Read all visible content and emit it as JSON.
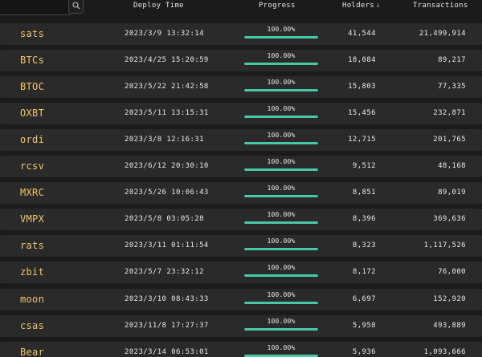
{
  "search": {
    "placeholder": ""
  },
  "header": {
    "deploy_time": "Deploy Time",
    "progress": "Progress",
    "holders": "Holders",
    "holders_sort_indicator": "↓",
    "transactions": "Transactions"
  },
  "colors": {
    "ticker": "#f2c66d",
    "progress_fill": "#46c9a6",
    "sort_arrow": "#f5a05a"
  },
  "rows": [
    {
      "ticker": "sats",
      "deploy_time": "2023/3/9 13:32:14",
      "progress": "100.00%",
      "progress_value": 100,
      "holders": "41,544",
      "transactions": "21,499,914"
    },
    {
      "ticker": "BTCs",
      "deploy_time": "2023/4/25 15:20:59",
      "progress": "100.00%",
      "progress_value": 100,
      "holders": "18,084",
      "transactions": "89,217"
    },
    {
      "ticker": "BTOC",
      "deploy_time": "2023/5/22 21:42:58",
      "progress": "100.00%",
      "progress_value": 100,
      "holders": "15,803",
      "transactions": "77,335"
    },
    {
      "ticker": "OXBT",
      "deploy_time": "2023/5/11 13:15:31",
      "progress": "100.00%",
      "progress_value": 100,
      "holders": "15,456",
      "transactions": "232,871"
    },
    {
      "ticker": "ordi",
      "deploy_time": "2023/3/8 12:16:31",
      "progress": "100.00%",
      "progress_value": 100,
      "holders": "12,715",
      "transactions": "201,765"
    },
    {
      "ticker": "rcsv",
      "deploy_time": "2023/6/12 20:30:10",
      "progress": "100.00%",
      "progress_value": 100,
      "holders": "9,512",
      "transactions": "48,168"
    },
    {
      "ticker": "MXRC",
      "deploy_time": "2023/5/26 10:06:43",
      "progress": "100.00%",
      "progress_value": 100,
      "holders": "8,851",
      "transactions": "89,019"
    },
    {
      "ticker": "VMPX",
      "deploy_time": "2023/5/8 03:05:28",
      "progress": "100.00%",
      "progress_value": 100,
      "holders": "8,396",
      "transactions": "369,636"
    },
    {
      "ticker": "rats",
      "deploy_time": "2023/3/11 01:11:54",
      "progress": "100.00%",
      "progress_value": 100,
      "holders": "8,323",
      "transactions": "1,117,526"
    },
    {
      "ticker": "zbit",
      "deploy_time": "2023/5/7 23:32:12",
      "progress": "100.00%",
      "progress_value": 100,
      "holders": "8,172",
      "transactions": "76,000"
    },
    {
      "ticker": "moon",
      "deploy_time": "2023/3/10 08:43:33",
      "progress": "100.00%",
      "progress_value": 100,
      "holders": "6,697",
      "transactions": "152,920"
    },
    {
      "ticker": "csas",
      "deploy_time": "2023/11/8 17:27:37",
      "progress": "100.00%",
      "progress_value": 100,
      "holders": "5,958",
      "transactions": "493,889"
    },
    {
      "ticker": "Bear",
      "deploy_time": "2023/3/14 06:53:01",
      "progress": "100.00%",
      "progress_value": 100,
      "holders": "5,936",
      "transactions": "1,093,666"
    }
  ]
}
